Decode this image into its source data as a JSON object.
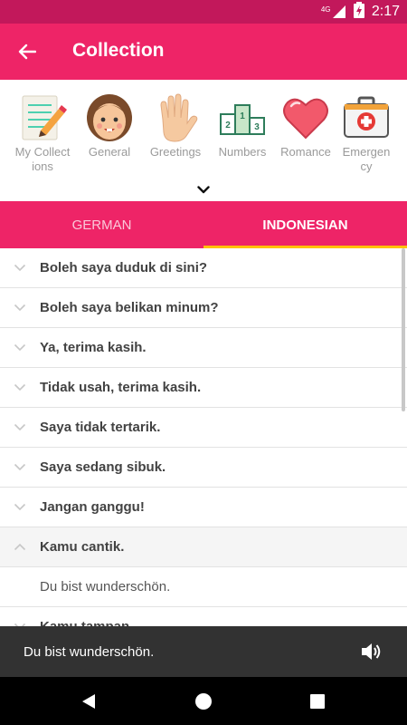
{
  "status_bar": {
    "network": "4G",
    "time": "2:17"
  },
  "app_bar": {
    "title": "Collection"
  },
  "categories": [
    {
      "label": "My Collect ions",
      "icon": "notebook-pencil-icon"
    },
    {
      "label": "General",
      "icon": "girl-face-icon"
    },
    {
      "label": "Greetings",
      "icon": "waving-hand-icon"
    },
    {
      "label": "Numbers",
      "icon": "podium-numbers-icon"
    },
    {
      "label": "Romance",
      "icon": "heart-icon"
    },
    {
      "label": "Emergen cy",
      "icon": "first-aid-kit-icon"
    }
  ],
  "tabs": [
    {
      "label": "GERMAN",
      "active": false
    },
    {
      "label": "INDONESIAN",
      "active": true
    }
  ],
  "phrases": [
    {
      "text": "Boleh saya duduk di sini?"
    },
    {
      "text": "Boleh saya belikan minum?"
    },
    {
      "text": "Ya, terima kasih."
    },
    {
      "text": "Tidak usah, terima kasih."
    },
    {
      "text": "Saya tidak tertarik."
    },
    {
      "text": "Saya sedang sibuk."
    },
    {
      "text": "Jangan ganggu!"
    },
    {
      "text": "Kamu cantik.",
      "expanded": true,
      "translation": "Du bist wunderschön."
    },
    {
      "text": "Kamu tampan."
    }
  ],
  "snackbar": {
    "text": "Du bist wunderschön."
  },
  "colors": {
    "primary": "#ee2467",
    "primary_dark": "#c2185b",
    "tab_indicator": "#ffc107"
  }
}
